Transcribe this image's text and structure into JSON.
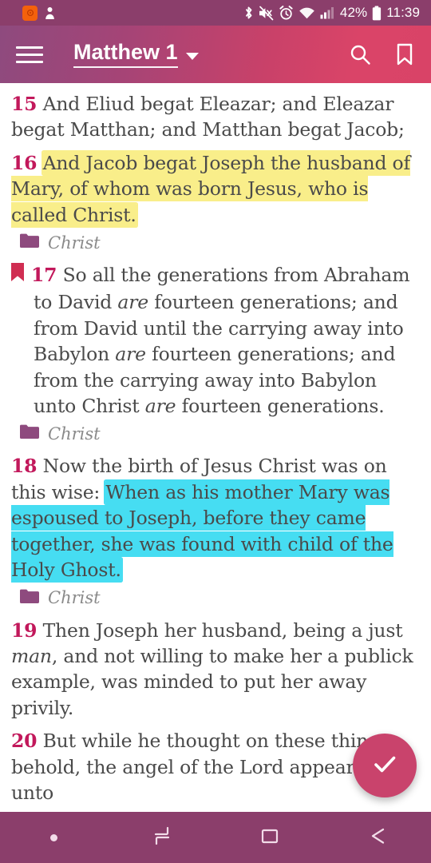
{
  "status_bar": {
    "background": "#8B3E6B",
    "notification_icons": [
      "app-notification-icon",
      "person-icon"
    ],
    "system_icons": [
      "bluetooth-icon",
      "mute-icon",
      "alarm-icon",
      "wifi-icon",
      "cellular-signal-icon"
    ],
    "battery_percent": "42%",
    "time": "11:39"
  },
  "app_bar": {
    "menu_icon": "hamburger-menu-icon",
    "title": "Matthew 1",
    "dropdown_icon": "chevron-down-icon",
    "search_icon": "search-icon",
    "bookmark_icon": "bookmark-icon",
    "gradient_start": "#8E4A7E",
    "gradient_end": "#D94367"
  },
  "reader": {
    "verse_number_color": "#C2185B",
    "highlight_yellow": "#F9EE8A",
    "highlight_cyan": "#46DDF2",
    "tag_folder_color": "#8E4A7E",
    "bookmark_marker_color": "#D02E52",
    "verses": [
      {
        "number": "15",
        "text_before": " And Eliud begat Eleazar; and Eleazar begat Matthan; and Matthan begat Jacob;",
        "highlight": "none",
        "tag": null,
        "bookmarked": false
      },
      {
        "number": "16",
        "text_before": " ",
        "highlighted_text": "And Jacob begat Joseph the husband of Mary, of whom was born Jesus, who is called Christ.",
        "highlight": "yellow",
        "tag": "Christ",
        "bookmarked": false
      },
      {
        "number": "17",
        "text_before": " So all the generations from Abraham to David ",
        "italic_1": "are",
        "text_mid_1": " fourteen generations; and from David until the carrying away into Babylon ",
        "italic_2": "are",
        "text_mid_2": " fourteen generations; and from the carrying away into Babylon unto Christ ",
        "italic_3": "are",
        "text_end": " fourteen generations.",
        "highlight": "none",
        "tag": "Christ",
        "bookmarked": true
      },
      {
        "number": "18",
        "text_before": " Now the birth of Jesus Christ was on this wise: ",
        "highlighted_text": "When as his mother Mary was espoused to Joseph, before they came together, she was found with child of the Holy Ghost.",
        "highlight": "cyan",
        "tag": "Christ",
        "bookmarked": false
      },
      {
        "number": "19",
        "text_before": " Then Joseph her husband, being a just ",
        "italic_1": "man",
        "text_end": ", and not willing to make her a publick example, was minded to put her away privily.",
        "highlight": "none",
        "tag": null,
        "bookmarked": false
      },
      {
        "number": "20",
        "text_before": " But while he thought on these things, behold, the angel of the Lord appeared unto",
        "highlight": "none",
        "tag": null,
        "bookmarked": false
      }
    ]
  },
  "fab": {
    "icon": "check-icon",
    "color": "#C9436C"
  },
  "nav_bar": {
    "background": "#8B3E6B",
    "items": [
      {
        "name": "nav-dot-indicator",
        "icon": "dot-icon"
      },
      {
        "name": "nav-recents",
        "icon": "recent-apps-icon"
      },
      {
        "name": "nav-home",
        "icon": "home-square-icon"
      },
      {
        "name": "nav-back",
        "icon": "back-arrow-icon"
      }
    ]
  }
}
